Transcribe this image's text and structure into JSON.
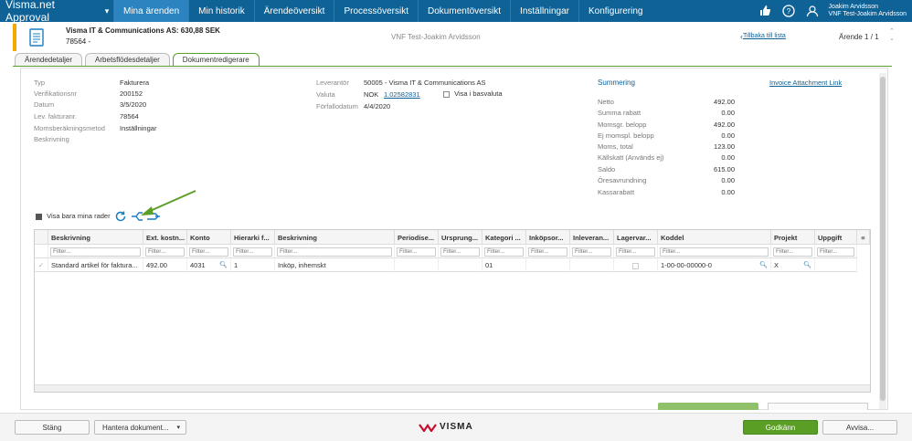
{
  "app": {
    "title": "Visma.net Approval"
  },
  "nav": {
    "items": [
      "Mina ärenden",
      "Min historik",
      "Ärendeöversikt",
      "Processöversikt",
      "Dokumentöversikt",
      "Inställningar",
      "Konfigurering"
    ],
    "active": "Mina ärenden"
  },
  "user": {
    "name": "Joakim Arvidsson",
    "org": "VNF Test-Joakim Arvidsson"
  },
  "header": {
    "title": "Visma IT & Communications AS: 630,88 SEK",
    "subtitle": "78564 -",
    "company": "VNF Test-Joakim Arvidsson",
    "back_link": "Tillbaka till lista",
    "count": "Ärende 1 / 1"
  },
  "tabs": [
    "Ärendedetaljer",
    "Arbetsflödesdetaljer",
    "Dokumentredigerare"
  ],
  "details": {
    "left": [
      {
        "label": "Typ",
        "value": "Fakturera"
      },
      {
        "label": "Verifikationsnr",
        "value": "200152"
      },
      {
        "label": "Datum",
        "value": "3/5/2020"
      },
      {
        "label": "Lev. fakturanr.",
        "value": "78564"
      },
      {
        "label": "Momsberäkningsmetod",
        "value": "Inställningar"
      },
      {
        "label": "Beskrivning",
        "value": ""
      }
    ],
    "supplier_label": "Leverantör",
    "supplier_value": "50005 - Visma IT & Communications AS",
    "currency_label": "Valuta",
    "currency_value": "NOK",
    "currency_rate": "1.02582831",
    "base_currency_label": "Visa i basvaluta",
    "due_label": "Förfallodatum",
    "due_value": "4/4/2020"
  },
  "summary": {
    "heading": "Summering",
    "attachment_link": "Invoice Attachment Link",
    "rows": [
      {
        "label": "Netto",
        "value": "492.00"
      },
      {
        "label": "Summa rabatt",
        "value": "0.00"
      },
      {
        "label": "Momsgr. belopp",
        "value": "492.00"
      },
      {
        "label": "Ej momspl. belopp",
        "value": "0.00"
      },
      {
        "label": "Moms, total",
        "value": "123.00"
      },
      {
        "label": "Källskatt (Används ej)",
        "value": "0.00"
      },
      {
        "label": "Saldo",
        "value": "615.00"
      },
      {
        "label": "Öresavrundning",
        "value": "0.00"
      },
      {
        "label": "Kassarabatt",
        "value": "0.00"
      }
    ]
  },
  "grid": {
    "only_my_rows": "Visa bara mina rader",
    "filter_placeholder": "Filter...",
    "columns": [
      "Beskrivning",
      "Ext. kostn...",
      "Konto",
      "Hierarki f...",
      "Beskrivning",
      "Periodise...",
      "Ursprung...",
      "Kategori ...",
      "Inköpsor...",
      "Inleveran...",
      "Lagervar...",
      "Koddel",
      "Projekt",
      "Uppgift"
    ],
    "rows": [
      [
        "Standard artikel för faktura...",
        "492.00",
        "4031",
        "1",
        "Inköp, inhemskt",
        "",
        "",
        "01",
        "",
        "",
        "",
        "1-00-00-00000-0",
        "X",
        ""
      ]
    ]
  },
  "footer": {
    "close": "Stäng",
    "manage": "Hantera dokument...",
    "logo": "VISMA",
    "approve": "Godkänn",
    "reject": "Avvisa..."
  },
  "colors": {
    "topbar": "#0f6296",
    "accent": "#5a9e26",
    "header_stripe": "#f1a900"
  }
}
